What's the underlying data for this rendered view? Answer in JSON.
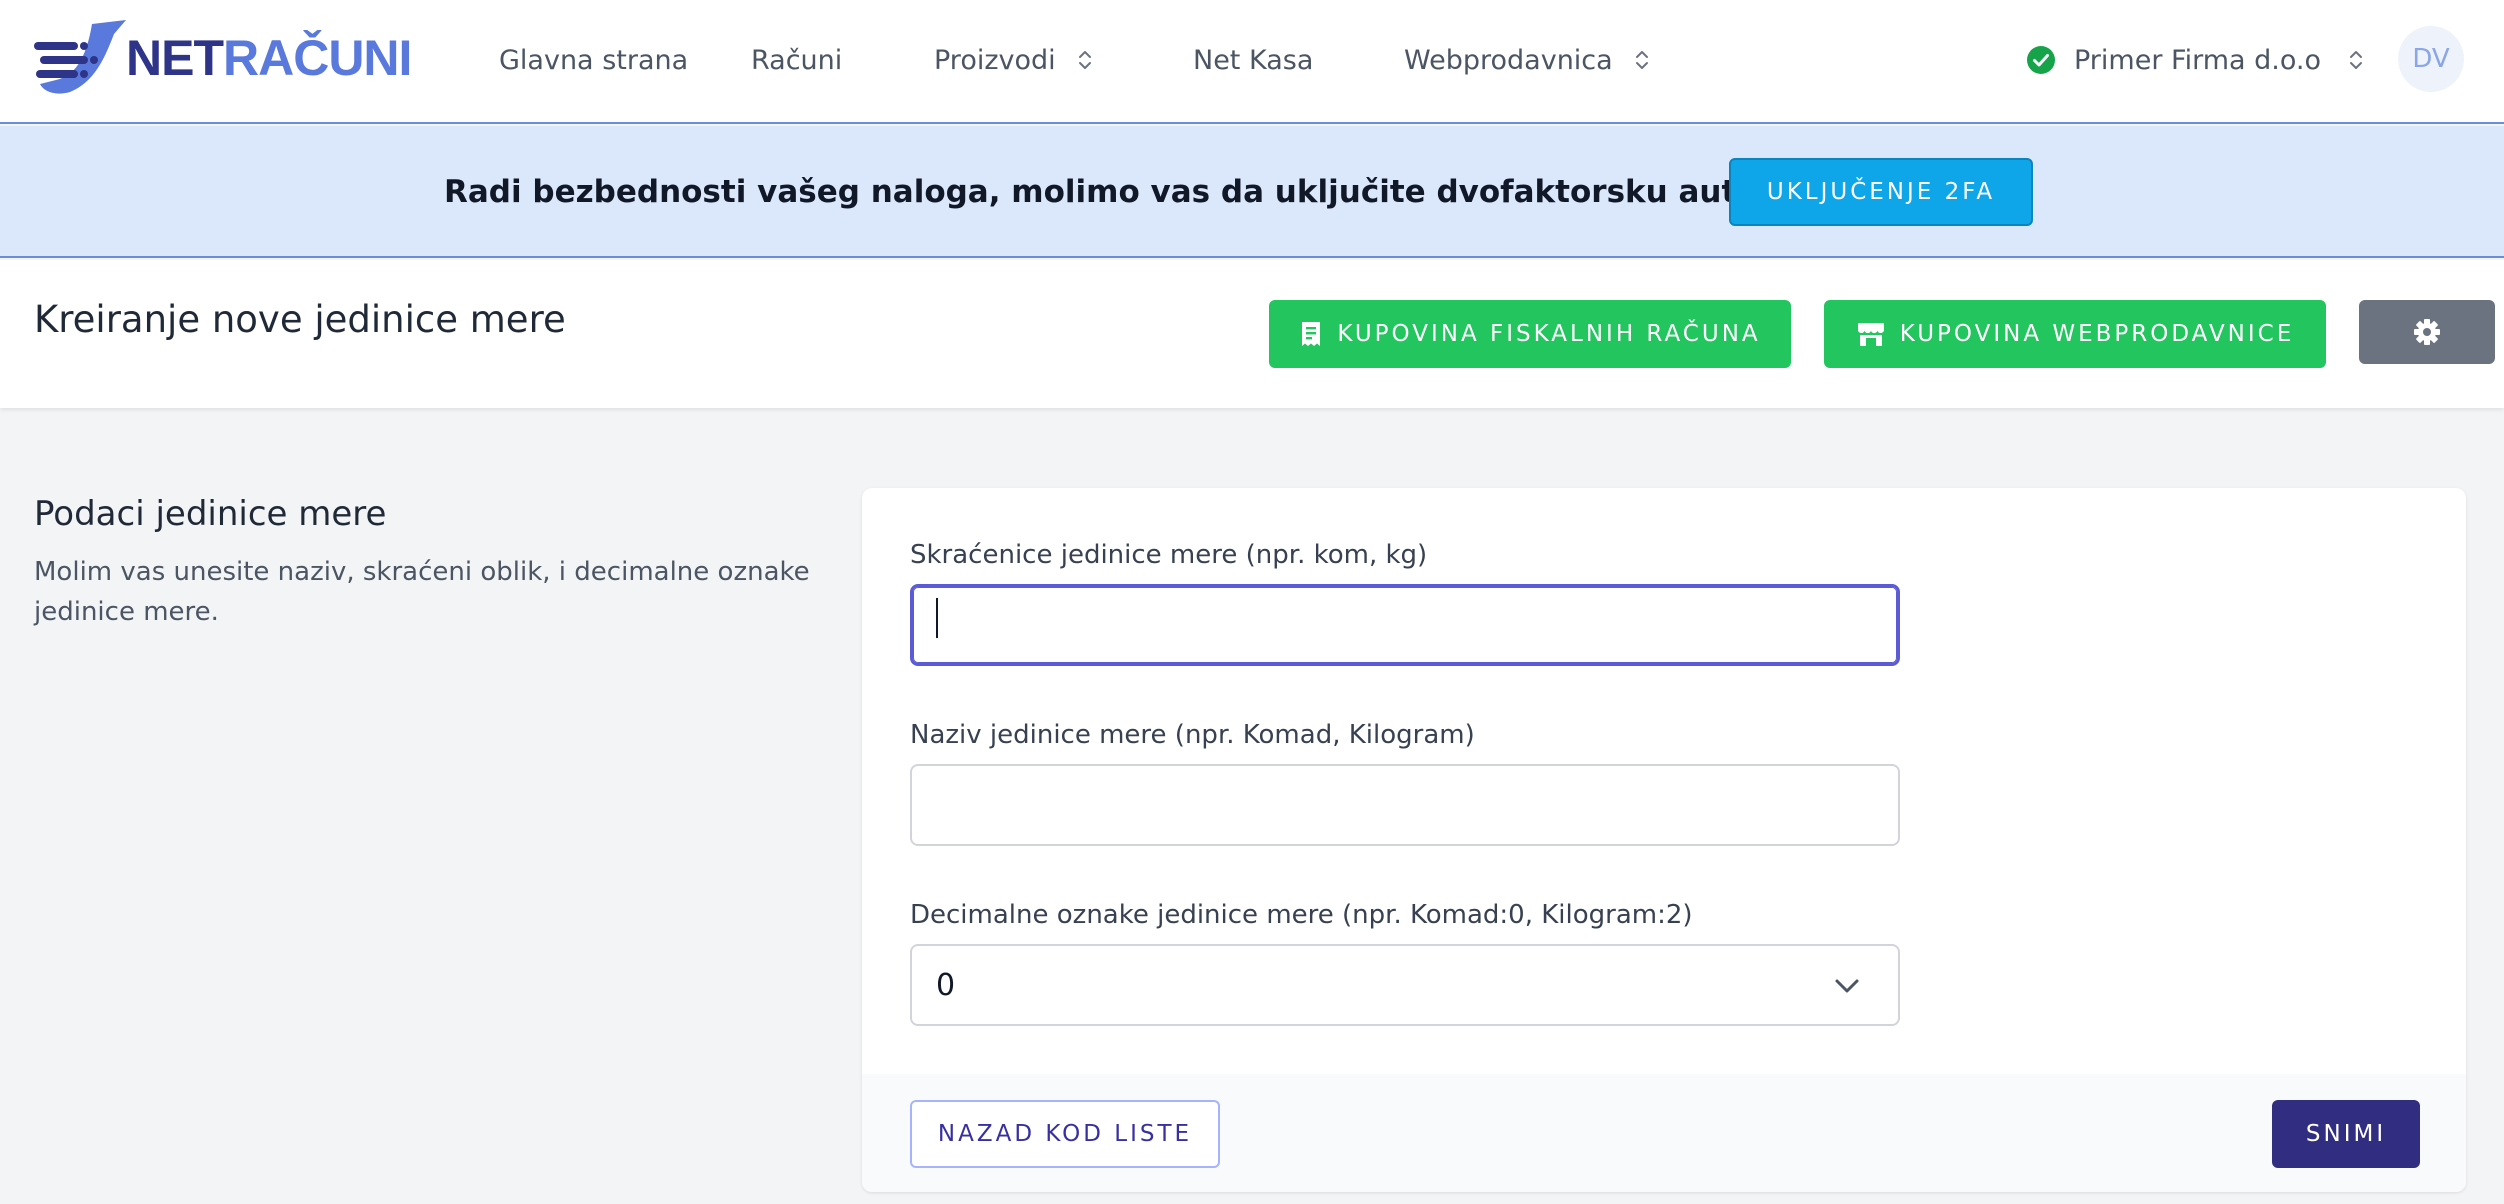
{
  "logo": {
    "part1": "NET",
    "part2": "RAČUNI"
  },
  "nav": {
    "items": [
      {
        "label": "Glavna strana",
        "has_dropdown": false
      },
      {
        "label": "Računi",
        "has_dropdown": false
      },
      {
        "label": "Proizvodi",
        "has_dropdown": true
      },
      {
        "label": "Net Kasa",
        "has_dropdown": false
      },
      {
        "label": "Webprodavnica",
        "has_dropdown": true
      }
    ],
    "company": "Primer Firma d.o.o",
    "avatar_initials": "DV"
  },
  "banner": {
    "message": "Radi bezbednosti vašeg naloga, molimo vas da uključite dvofaktorsku autentikaciju!",
    "button": "UKLJUČENJE 2FA"
  },
  "header": {
    "title": "Kreiranje nove jedinice mere",
    "buy_fiscal": "KUPOVINA FISKALNIH RAČUNA",
    "buy_webshop": "KUPOVINA WEBPRODAVNICE"
  },
  "section": {
    "title": "Podaci jedinice mere",
    "description": "Molim vas unesite naziv, skraćeni oblik, i decimalne oznake jedinice mere."
  },
  "form": {
    "abbr_label": "Skraćenice jedinice mere (npr. kom, kg)",
    "abbr_value": "",
    "name_label": "Naziv jedinice mere (npr. Komad, Kilogram)",
    "name_value": "",
    "decimals_label": "Decimalne oznake jedinice mere (npr. Komad:0, Kilogram:2)",
    "decimals_value": "0"
  },
  "footer": {
    "back": "NAZAD KOD LISTE",
    "save": "SNIMI"
  },
  "colors": {
    "brand_dark": "#2e3488",
    "brand_light": "#5a79dc",
    "banner_bg": "#dbe8fc",
    "cyan_button": "#0ea5e9",
    "green_button": "#22c55e",
    "save_button": "#312e81",
    "focus_ring": "#5b5bd6"
  }
}
